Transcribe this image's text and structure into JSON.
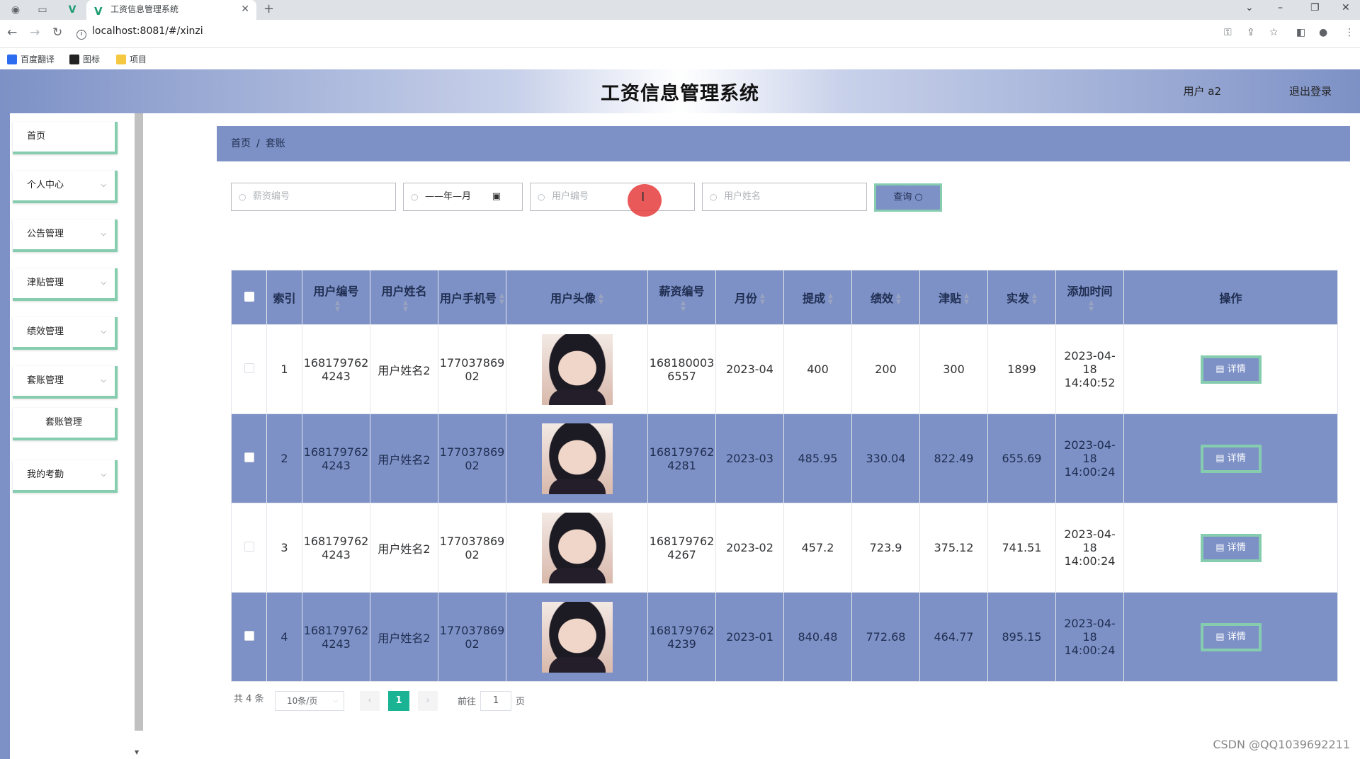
{
  "browser": {
    "tab_title": "工资信息管理系统",
    "url": "localhost:8081/#/xinzi",
    "bookmarks": [
      "百度翻译",
      "图标",
      "项目"
    ]
  },
  "header": {
    "title": "工资信息管理系统",
    "user": "用户 a2",
    "logout": "退出登录"
  },
  "sidebar": {
    "items": [
      {
        "label": "首页"
      },
      {
        "label": "个人中心"
      },
      {
        "label": "公告管理"
      },
      {
        "label": "津贴管理"
      },
      {
        "label": "绩效管理"
      },
      {
        "label": "套账管理"
      },
      {
        "label": "套账管理",
        "submenu": true
      },
      {
        "label": "我的考勤"
      }
    ]
  },
  "breadcrumb": {
    "home": "首页",
    "sep": "/",
    "current": "套账"
  },
  "search": {
    "salary_no_placeholder": "薪资编号",
    "month_value": "——年—月",
    "user_no_placeholder": "用户编号",
    "user_name_placeholder": "用户姓名",
    "query_label": "查询"
  },
  "table": {
    "headers": {
      "index": "索引",
      "user_no": "用户编号",
      "user_name": "用户姓名",
      "phone": "用户手机号",
      "avatar": "用户头像",
      "salary_no": "薪资编号",
      "month": "月份",
      "commission": "提成",
      "performance": "绩效",
      "allowance": "津贴",
      "actual": "实发",
      "added": "添加时间",
      "action": "操作"
    },
    "detail_label": "详情",
    "rows": [
      {
        "index": "1",
        "user_no": "1681797624243",
        "user_name": "用户姓名2",
        "phone": "17703786902",
        "salary_no": "1681800036557",
        "month": "2023-04",
        "commission": "400",
        "performance": "200",
        "allowance": "300",
        "actual": "1899",
        "added": "2023-04-18 14:40:52"
      },
      {
        "index": "2",
        "user_no": "1681797624243",
        "user_name": "用户姓名2",
        "phone": "17703786902",
        "salary_no": "1681797624281",
        "month": "2023-03",
        "commission": "485.95",
        "performance": "330.04",
        "allowance": "822.49",
        "actual": "655.69",
        "added": "2023-04-18 14:00:24"
      },
      {
        "index": "3",
        "user_no": "1681797624243",
        "user_name": "用户姓名2",
        "phone": "17703786902",
        "salary_no": "1681797624267",
        "month": "2023-02",
        "commission": "457.2",
        "performance": "723.9",
        "allowance": "375.12",
        "actual": "741.51",
        "added": "2023-04-18 14:00:24"
      },
      {
        "index": "4",
        "user_no": "1681797624243",
        "user_name": "用户姓名2",
        "phone": "17703786902",
        "salary_no": "1681797624239",
        "month": "2023-01",
        "commission": "840.48",
        "performance": "772.68",
        "allowance": "464.77",
        "actual": "895.15",
        "added": "2023-04-18 14:00:24"
      }
    ]
  },
  "pagination": {
    "total": "共 4 条",
    "page_size": "10条/页",
    "current": "1",
    "goto_label": "前往",
    "goto_value": "1",
    "page_unit": "页"
  },
  "watermark": "CSDN @QQ1039692211",
  "colors": {
    "accent": "#7d91c6",
    "border_green": "#86cdb0",
    "pager_active": "#1ab394"
  }
}
